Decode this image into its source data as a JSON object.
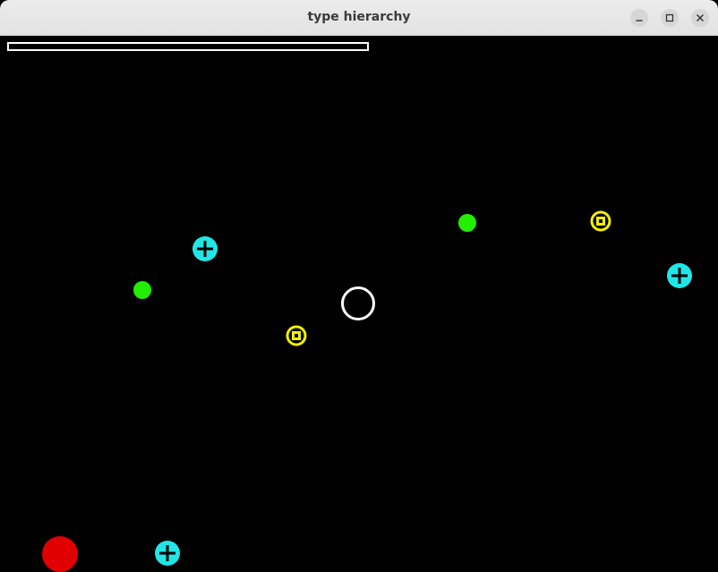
{
  "window": {
    "title": "type hierarchy"
  },
  "hud": {
    "health_fraction": 0.0
  },
  "entities": [
    {
      "kind": "player",
      "icon": "player-ring-icon",
      "color": "#ffffff"
    },
    {
      "kind": "green-dot",
      "icon": "green-dot-icon",
      "color": "#22ee00"
    },
    {
      "kind": "green-dot",
      "icon": "green-dot-icon",
      "color": "#22ee00"
    },
    {
      "kind": "cyan-cross",
      "icon": "cyan-cross-icon",
      "color": "#22e6e6"
    },
    {
      "kind": "cyan-cross",
      "icon": "cyan-cross-icon",
      "color": "#22e6e6"
    },
    {
      "kind": "cyan-cross",
      "icon": "cyan-cross-icon",
      "color": "#22e6e6"
    },
    {
      "kind": "yellow-square",
      "icon": "yellow-square-icon",
      "color": "#f0f000"
    },
    {
      "kind": "yellow-square",
      "icon": "yellow-square-icon",
      "color": "#f0f000"
    },
    {
      "kind": "red-ball",
      "icon": "red-ball-icon",
      "color": "#e00000"
    }
  ]
}
